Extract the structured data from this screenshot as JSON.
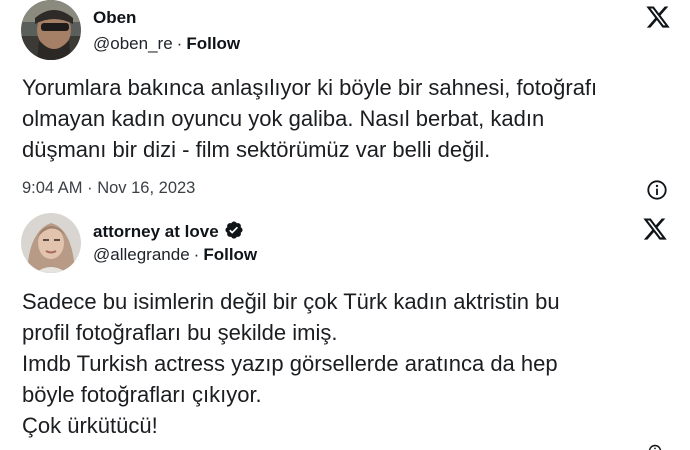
{
  "tweets": [
    {
      "display_name": "Oben",
      "handle": "@oben_re",
      "separator": "·",
      "follow_label": "Follow",
      "text": "Yorumlara bakınca anlaşılıyor ki böyle bir sahnesi, fotoğrafı\nolmayan kadın oyuncu yok galiba. Nasıl berbat, kadın\ndüşmanı bir dizi - film sektörümüz var belli değil.",
      "timestamp": "9:04 AM · Nov 16, 2023",
      "avatar_icon": "avatar-photo",
      "platform_icon": "x-logo-icon",
      "info_icon": "info-icon"
    },
    {
      "display_name": "attorney at love",
      "verified": true,
      "handle": "@allegrande",
      "separator": "·",
      "follow_label": "Follow",
      "text": "Sadece bu isimlerin değil bir çok Türk kadın aktristin bu\nprofil fotoğrafları bu şekilde imiş.\nImdb Turkish actress yazıp görsellerde aratınca da hep\nböyle fotoğrafları çıkıyor.\nÇok ürkütücü!",
      "avatar_icon": "avatar-photo",
      "platform_icon": "x-logo-icon",
      "verified_icon": "verified-badge-icon"
    }
  ],
  "colors": {
    "text_primary": "#0f1419",
    "text_secondary": "#3b4045",
    "verified_badge": "#0f1419"
  }
}
